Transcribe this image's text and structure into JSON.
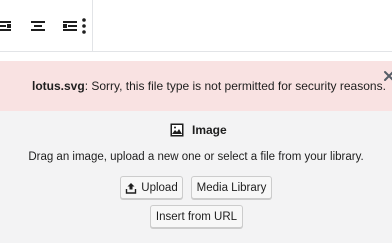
{
  "toolbar": {
    "buttons": [
      {
        "icon": "align-left-icon"
      },
      {
        "icon": "align-center-icon"
      },
      {
        "icon": "align-right-icon"
      },
      {
        "icon": "more-vertical-icon"
      }
    ]
  },
  "notice": {
    "filename": "lotus.svg",
    "message": ": Sorry, this file type is not permitted for security reasons.",
    "close_icon": "close-icon",
    "background": "#f9e2e2"
  },
  "placeholder": {
    "icon": "image-icon",
    "title": "Image",
    "instructions": "Drag an image, upload a new one or select a file from your library.",
    "upload_label": "Upload",
    "media_library_label": "Media Library",
    "insert_url_label": "Insert from URL",
    "background": "#f3f3f4"
  }
}
